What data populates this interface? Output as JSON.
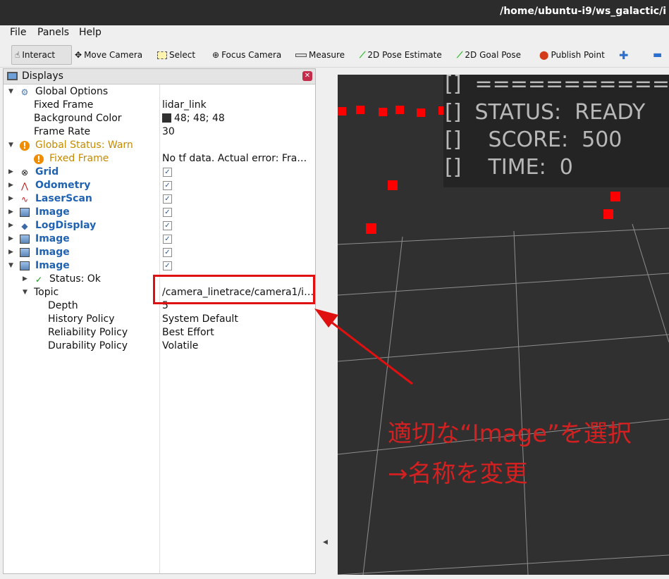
{
  "window": {
    "title": "/home/ubuntu-i9/ws_galactic/i"
  },
  "menu": [
    "File",
    "Panels",
    "Help"
  ],
  "toolbar": {
    "interact": "Interact",
    "move_camera": "Move Camera",
    "select": "Select",
    "focus_camera": "Focus Camera",
    "measure": "Measure",
    "pose_estimate": "2D Pose Estimate",
    "goal_pose": "2D Goal Pose",
    "publish_point": "Publish Point"
  },
  "displays": {
    "title": "Displays",
    "rows": [
      {
        "name": "Global Options",
        "value": ""
      },
      {
        "name": "Fixed Frame",
        "value": "lidar_link"
      },
      {
        "name": "Background Color",
        "value": "48; 48; 48"
      },
      {
        "name": "Frame Rate",
        "value": "30"
      },
      {
        "name": "Global Status: Warn",
        "value": ""
      },
      {
        "name": "Fixed Frame",
        "value": "No tf data.  Actual error: Fra…"
      },
      {
        "name": "Grid",
        "value": "✓"
      },
      {
        "name": "Odometry",
        "value": "✓"
      },
      {
        "name": "LaserScan",
        "value": "✓"
      },
      {
        "name": "Image",
        "value": "✓"
      },
      {
        "name": "LogDisplay",
        "value": "✓"
      },
      {
        "name": "Image",
        "value": "✓"
      },
      {
        "name": "Image",
        "value": "✓"
      },
      {
        "name": "Image",
        "value": "✓"
      },
      {
        "name": "Status: Ok",
        "value": ""
      },
      {
        "name": "Topic",
        "value": "/camera_linetrace/camera1/i…"
      },
      {
        "name": "Depth",
        "value": "5"
      },
      {
        "name": "History Policy",
        "value": "System Default"
      },
      {
        "name": "Reliability Policy",
        "value": "Best Effort"
      },
      {
        "name": "Durability Policy",
        "value": "Volatile"
      }
    ]
  },
  "hud": {
    "line1": "[]  ================",
    "line2": "[]  STATUS:  READY",
    "line3": "[]    SCORE:  500",
    "line4": "[]    TIME:  0"
  },
  "annotation": {
    "line1": "適切な“Image”を選択",
    "line2": "→名称を変更"
  },
  "colors": {
    "annotation": "#e01010",
    "background": "#303030",
    "link": "#2163b3",
    "warn": "#c58a00"
  }
}
